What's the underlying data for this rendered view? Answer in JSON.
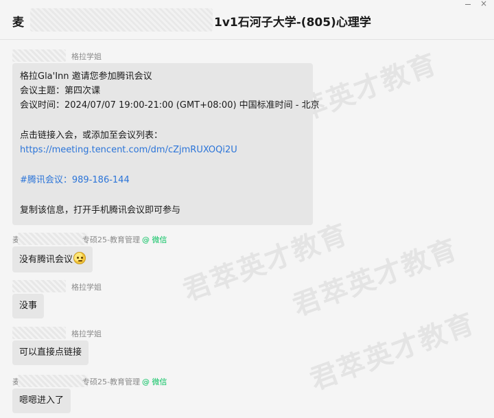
{
  "header": {
    "title_prefix": "麦",
    "title_main": "1v1石河子大学-(805)心理学"
  },
  "window_controls": {
    "minimize_label": "—",
    "close_label": "×"
  },
  "watermark": {
    "text": "君萃英才教育"
  },
  "messages": [
    {
      "sender": "格拉学姐",
      "lines": [
        "格拉Gla'Inn 邀请您参加腾讯会议",
        "会议主题：第四次课",
        "会议时间：2024/07/07 19:00-21:00 (GMT+08:00) 中国标准时间 - 北京",
        "",
        "点击链接入会，或添加至会议列表：",
        "https://meeting.tencent.com/dm/cZjmRUXOQi2U",
        "",
        "#腾讯会议：989-186-144",
        "",
        "复制该信息，打开手机腾讯会议即可参与"
      ]
    },
    {
      "sender_prefix": "麦",
      "sender": "专硕25-教育管理",
      "wechat_tag": "@ 微信",
      "text": "没有腾讯会议"
    },
    {
      "sender": "格拉学姐",
      "text": "没事"
    },
    {
      "sender": "格拉学姐",
      "text": "可以直接点链接"
    },
    {
      "sender_prefix": "麦",
      "sender": "专硕25-教育管理",
      "wechat_tag": "@ 微信",
      "text": "嗯嗯进入了"
    }
  ],
  "colors": {
    "background": "#f5f5f5",
    "bubble": "#e6e6e6",
    "link": "#2b74d8",
    "wechat_green": "#07c160"
  }
}
